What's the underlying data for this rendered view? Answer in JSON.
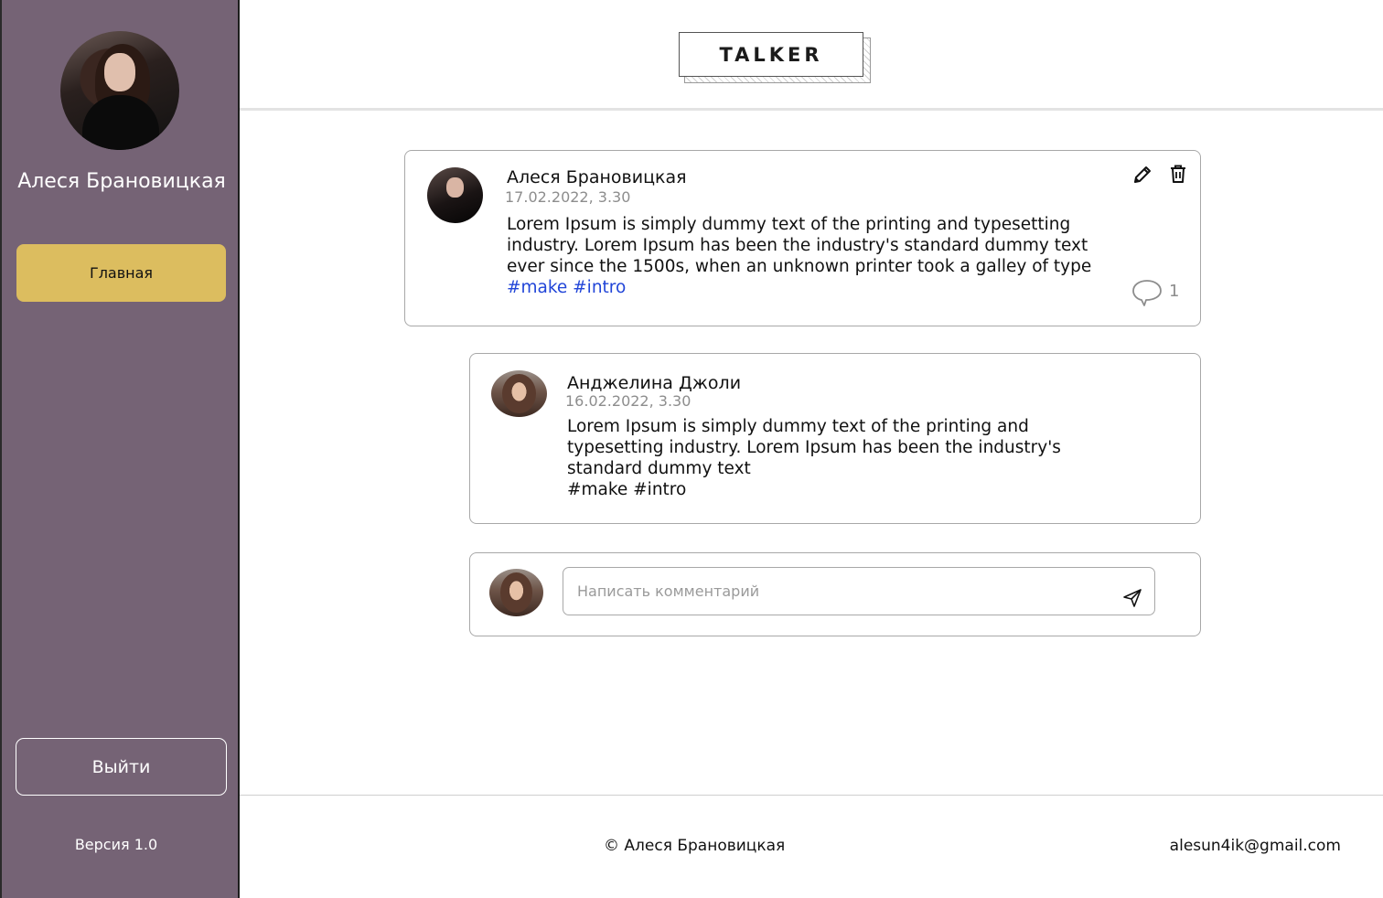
{
  "sidebar": {
    "profile_name": "Алеся Брановицкая",
    "nav_home": "Главная",
    "logout": "Выйти",
    "version": "Версия 1.0",
    "bg_color": "#756375",
    "active_color": "#dcbd5f"
  },
  "header": {
    "logo": "TALKER"
  },
  "post": {
    "author": "Алеся Брановицкая",
    "date": "17.02.2022, 3.30",
    "line1": "Lorem Ipsum is simply dummy text of the printing and typesetting",
    "line2": "industry. Lorem Ipsum has been the industry's standard dummy text",
    "line3": "ever since the 1500s, when an unknown printer took a galley of type",
    "tags": "#make #intro",
    "comments_count": "1",
    "edit_icon": "pencil-icon",
    "delete_icon": "trash-icon",
    "comment_icon": "speech-bubble-icon"
  },
  "comment": {
    "author": "Анджелина Джоли",
    "date": "16.02.2022, 3.30",
    "line1": "Lorem Ipsum is simply dummy text of the printing and",
    "line2": "typesetting industry. Lorem Ipsum has been the industry's",
    "line3": "standard dummy text",
    "tags": "#make #intro"
  },
  "compose": {
    "placeholder": "Написать комментарий",
    "send_icon": "send-icon"
  },
  "footer": {
    "copyright": "© Алеся Брановицкая",
    "email": "alesun4ik@gmail.com"
  },
  "colors": {
    "tag_link": "#2145d8",
    "muted": "#8d8d8d"
  }
}
